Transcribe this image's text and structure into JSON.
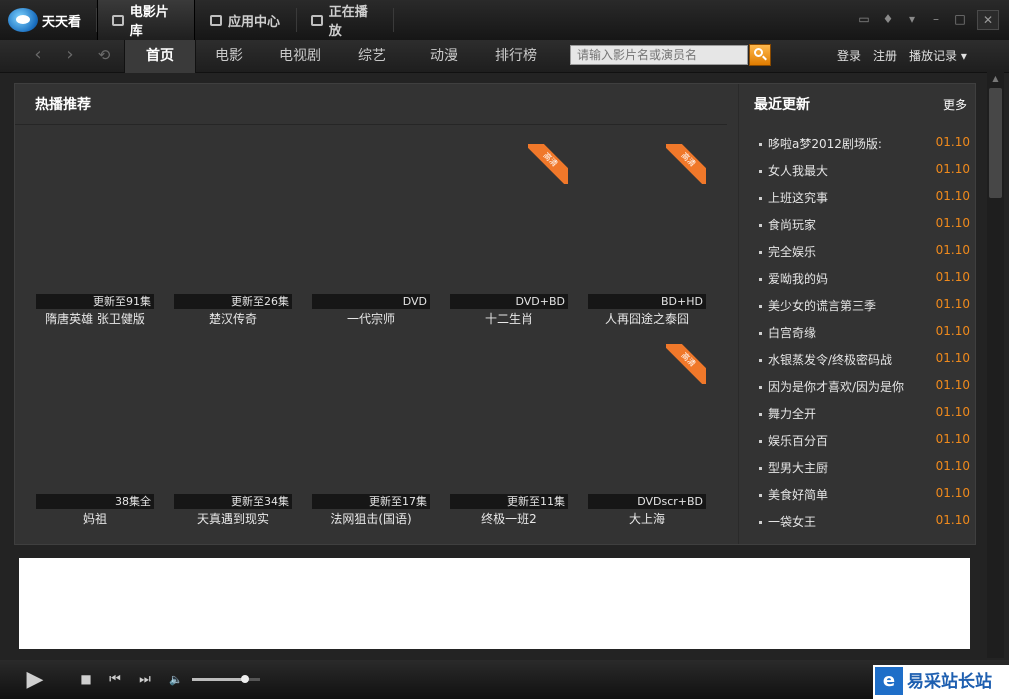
{
  "app": {
    "name": "天天看"
  },
  "titlebar": {
    "tabs": [
      {
        "label": "电影片库",
        "icon": "film-grid-icon"
      },
      {
        "label": "应用中心",
        "icon": "app-center-icon"
      },
      {
        "label": "正在播放",
        "icon": "play-square-icon"
      }
    ],
    "active_tab": "电影片库",
    "window_icons": [
      "skin-icon",
      "shirt-icon",
      "menu-icon",
      "minimize-icon",
      "maximize-icon",
      "close-icon"
    ]
  },
  "nav": {
    "back_icon": "‹",
    "forward_icon": "›",
    "refresh_icon": "⟲",
    "tabs": [
      "首页",
      "电影",
      "电视剧",
      "综艺",
      "动漫",
      "排行榜"
    ],
    "active_tab": "首页",
    "search": {
      "placeholder": "请输入影片名或演员名"
    },
    "login": "登录",
    "register": "注册",
    "history": "播放记录 ▾"
  },
  "hot": {
    "title": "热播推荐",
    "items": [
      {
        "badge": "",
        "info": "更新至91集",
        "title": "隋唐英雄 张卫健版"
      },
      {
        "badge": "",
        "info": "更新至26集",
        "title": "楚汉传奇"
      },
      {
        "badge": "",
        "info": "DVD",
        "title": "一代宗师"
      },
      {
        "badge": "高清",
        "info": "DVD+BD",
        "title": "十二生肖"
      },
      {
        "badge": "高清",
        "info": "BD+HD",
        "title": "人再囧途之泰囧"
      },
      {
        "badge": "",
        "info": "38集全",
        "title": "妈祖"
      },
      {
        "badge": "",
        "info": "更新至34集",
        "title": "天真遇到现实"
      },
      {
        "badge": "",
        "info": "更新至17集",
        "title": "法网狙击(国语)"
      },
      {
        "badge": "",
        "info": "更新至11集",
        "title": "终极一班2"
      },
      {
        "badge": "高清",
        "info": "DVDscr+BD",
        "title": "大上海"
      }
    ]
  },
  "recent": {
    "title": "最近更新",
    "more": "更多",
    "items": [
      {
        "name": "哆啦a梦2012剧场版:",
        "date": "01.10"
      },
      {
        "name": "女人我最大",
        "date": "01.10"
      },
      {
        "name": "上班这究事",
        "date": "01.10"
      },
      {
        "name": "食尚玩家",
        "date": "01.10"
      },
      {
        "name": "完全娱乐",
        "date": "01.10"
      },
      {
        "name": "爱呦我的妈",
        "date": "01.10"
      },
      {
        "name": "美少女的谎言第三季",
        "date": "01.10"
      },
      {
        "name": "白宫奇缘",
        "date": "01.10"
      },
      {
        "name": "水银蒸发令/终极密码战",
        "date": "01.10"
      },
      {
        "name": "因为是你才喜欢/因为是你",
        "date": "01.10"
      },
      {
        "name": "舞力全开",
        "date": "01.10"
      },
      {
        "name": "娱乐百分百",
        "date": "01.10"
      },
      {
        "name": "型男大主厨",
        "date": "01.10"
      },
      {
        "name": "美食好简单",
        "date": "01.10"
      },
      {
        "name": "一袋女王",
        "date": "01.10"
      }
    ]
  },
  "player": {
    "play_icon": "▶",
    "stop_icon": "■",
    "prev_icon": "⏮",
    "next_icon": "⏭",
    "volume_icon": "🔈",
    "volume_level": 0.78
  },
  "watermark": {
    "icon": "e",
    "text": "易采站长站"
  },
  "colors": {
    "accent": "#f08a1c",
    "badge": "#f0782a"
  }
}
